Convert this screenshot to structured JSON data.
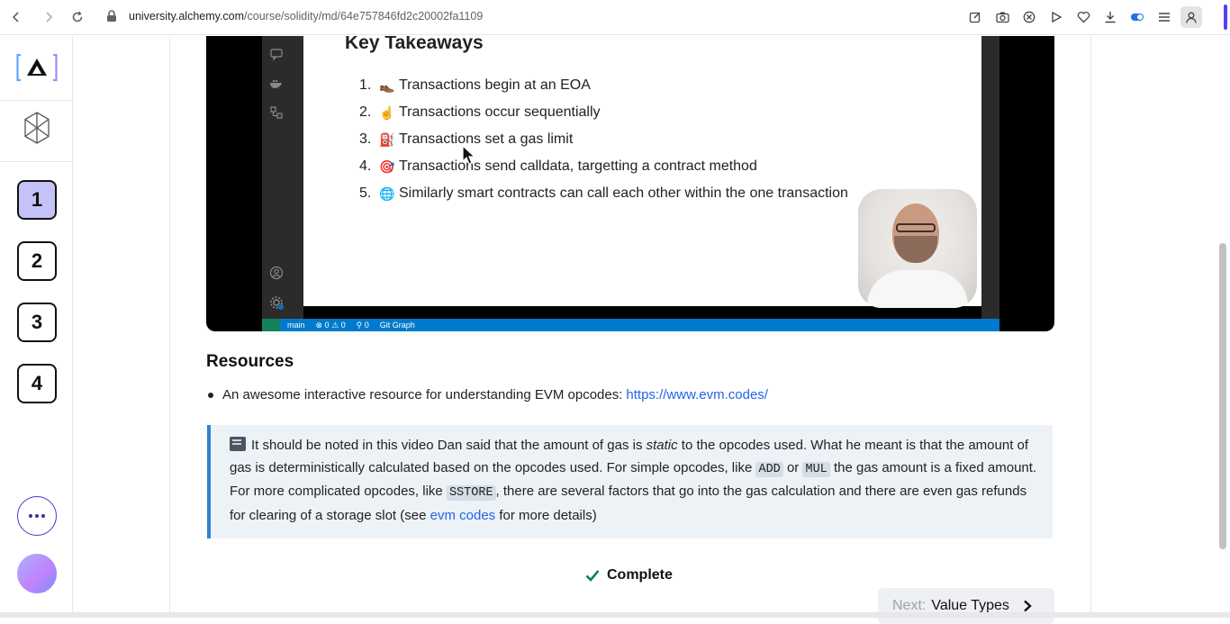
{
  "browser": {
    "url_domain": "university.alchemy.com",
    "url_path": "/course/solidity/md/64e757846fd2c20002fa1109"
  },
  "sidebar": {
    "logo_text": "[A]",
    "steps": [
      {
        "label": "1",
        "active": true
      },
      {
        "label": "2",
        "active": false
      },
      {
        "label": "3",
        "active": false
      },
      {
        "label": "4",
        "active": false
      }
    ]
  },
  "video": {
    "slide_title": "Key Takeaways",
    "takeaways": [
      {
        "num": "1.",
        "icon": "boot-icon",
        "emoji": "👞",
        "text": "Transactions begin at an EOA"
      },
      {
        "num": "2.",
        "icon": "pointing-finger-icon",
        "emoji": "☝",
        "text": "Transactions occur sequentially"
      },
      {
        "num": "3.",
        "icon": "fuel-pump-icon",
        "emoji": "⛽",
        "text": "Transactions set a gas limit"
      },
      {
        "num": "4.",
        "icon": "target-icon",
        "emoji": "🎯",
        "text": "Transactions send calldata, targetting a contract method"
      },
      {
        "num": "5.",
        "icon": "globe-icon",
        "emoji": "🌐",
        "text": "Similarly smart contracts can call each other within the one transaction"
      }
    ],
    "status_branch": "main",
    "status_problems": "⊗ 0 ⚠ 0",
    "status_ports": "⚲ 0",
    "status_git_graph": "Git Graph"
  },
  "resources": {
    "heading": "Resources",
    "item_text": "An awesome interactive resource for understanding EVM opcodes: ",
    "item_link": "https://www.evm.codes/"
  },
  "note": {
    "part1": "It should be noted in this video Dan said that the amount of gas is ",
    "em": "static",
    "part2": " to the opcodes used. What he meant is that the amount of gas is deterministically calculated based on the opcodes used. For simple opcodes, like ",
    "code1": "ADD",
    "part3": " or ",
    "code2": "MUL",
    "part4": " the gas amount is a fixed amount. For more complicated opcodes, like ",
    "code3": "SSTORE",
    "part5": ", there are several factors that go into the gas calculation and there are even gas refunds for clearing of a storage slot (see ",
    "link": "evm codes",
    "part6": " for more details)"
  },
  "footer": {
    "complete_label": "Complete",
    "next_label": "Next:",
    "next_title": "Value Types"
  }
}
